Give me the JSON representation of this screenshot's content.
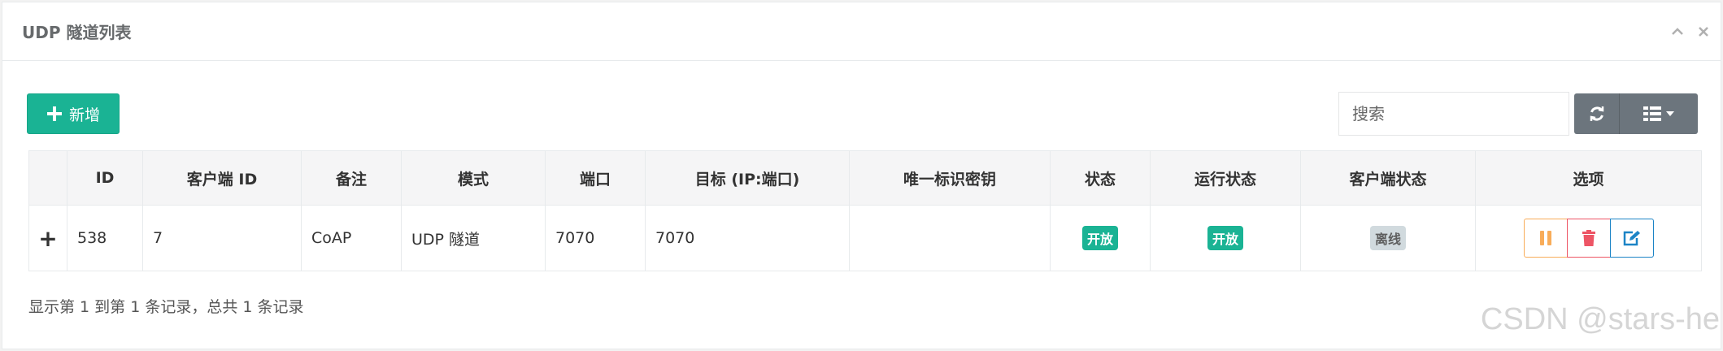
{
  "panel": {
    "title": "UDP 隧道列表",
    "tools": {
      "collapse_icon": "chevron-up-icon",
      "close_icon": "close-icon"
    }
  },
  "toolbar": {
    "add_label": "新增",
    "search_placeholder": "搜索",
    "refresh_icon": "refresh-icon",
    "columns_icon": "list-columns-icon"
  },
  "table": {
    "columns": [
      "",
      "ID",
      "客户端 ID",
      "备注",
      "模式",
      "端口",
      "目标 (IP:端口)",
      "唯一标识密钥",
      "状态",
      "运行状态",
      "客户端状态",
      "选项"
    ],
    "rows": [
      {
        "expand": "+",
        "id": "538",
        "client_id": "7",
        "remark": "CoAP",
        "mode": "UDP 隧道",
        "port": "7070",
        "target": "7070",
        "secret_key": "",
        "status": "开放",
        "run_status": "开放",
        "client_status": "离线"
      }
    ]
  },
  "footer": {
    "info": "显示第 1 到第 1 条记录，总共 1 条记录"
  },
  "watermark": "CSDN @stars-he",
  "colors": {
    "primary": "#1ab394",
    "gray_button": "#6c757d",
    "warning": "#f8ac59",
    "danger": "#ed5565",
    "info": "#1c84c6",
    "badge_gray": "#d1dade"
  }
}
